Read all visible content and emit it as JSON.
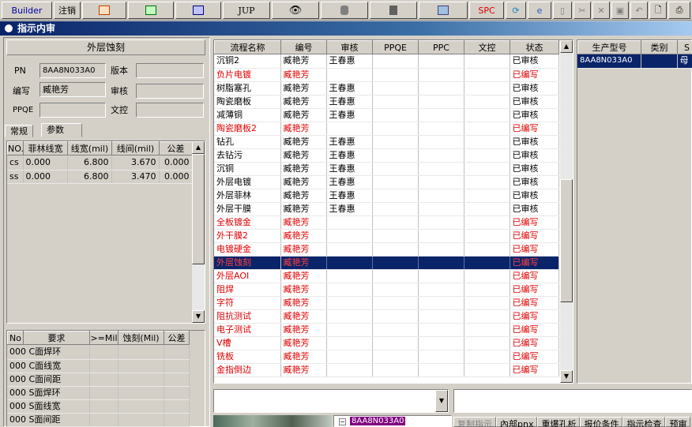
{
  "toolbar": {
    "builder": "Builder",
    "logout": "注销",
    "jup": "JUP",
    "spc": "SPC"
  },
  "window": {
    "title": "指示内审"
  },
  "left": {
    "header": "外层蚀刻",
    "pn_label": "PN",
    "pn_value": "8AA8N033A0",
    "version_label": "版本",
    "version_value": "",
    "editor_label": "编写",
    "editor_value": "臧艳芳",
    "reviewer_label": "审核",
    "reviewer_value": "",
    "ppqe_label": "PPQE",
    "ppqe_value": "",
    "doc_label": "文控",
    "doc_value": "",
    "tabs": [
      "常规",
      "参数"
    ],
    "param_headers": [
      "NO.",
      "菲林线宽",
      "线宽(mil)",
      "线间(mil)",
      "公差"
    ],
    "params": [
      [
        "cs",
        "0.000",
        "6.800",
        "3.670",
        "0.000"
      ],
      [
        "ss",
        "0.000",
        "6.800",
        "3.470",
        "0.000"
      ]
    ],
    "req_headers": [
      "No",
      "要求",
      ">=Mil",
      "蚀刻(Mil)",
      "公差"
    ],
    "reqs": [
      "000 C面焊环",
      "000 C面线宽",
      "000 C面间距",
      "000 S面焊环",
      "000 S面线宽",
      "000 S面间距"
    ]
  },
  "process": {
    "headers": [
      "流程名称",
      "编号",
      "审核",
      "PPQE",
      "PPC",
      "文控",
      "状态"
    ],
    "rows": [
      {
        "name": "沉铜2",
        "code": "臧艳芳",
        "rev": "王春惠",
        "status": "已审核",
        "red": false
      },
      {
        "name": "负片电镀",
        "code": "臧艳芳",
        "rev": "",
        "status": "已编写",
        "red": true
      },
      {
        "name": "树脂塞孔",
        "code": "臧艳芳",
        "rev": "王春惠",
        "status": "已审核",
        "red": false
      },
      {
        "name": "陶瓷磨板",
        "code": "臧艳芳",
        "rev": "王春惠",
        "status": "已审核",
        "red": false
      },
      {
        "name": "减薄铜",
        "code": "臧艳芳",
        "rev": "王春惠",
        "status": "已审核",
        "red": false
      },
      {
        "name": "陶瓷磨板2",
        "code": "臧艳芳",
        "rev": "",
        "status": "已编写",
        "red": true
      },
      {
        "name": "钻孔",
        "code": "臧艳芳",
        "rev": "王春惠",
        "status": "已审核",
        "red": false
      },
      {
        "name": "去钻污",
        "code": "臧艳芳",
        "rev": "王春惠",
        "status": "已审核",
        "red": false
      },
      {
        "name": "沉铜",
        "code": "臧艳芳",
        "rev": "王春惠",
        "status": "已审核",
        "red": false
      },
      {
        "name": "外层电镀",
        "code": "臧艳芳",
        "rev": "王春惠",
        "status": "已审核",
        "red": false
      },
      {
        "name": "外层菲林",
        "code": "臧艳芳",
        "rev": "王春惠",
        "status": "已审核",
        "red": false
      },
      {
        "name": "外层干膜",
        "code": "臧艳芳",
        "rev": "王春惠",
        "status": "已审核",
        "red": false
      },
      {
        "name": "全板镀金",
        "code": "臧艳芳",
        "rev": "",
        "status": "已编写",
        "red": true
      },
      {
        "name": "外干膜2",
        "code": "臧艳芳",
        "rev": "",
        "status": "已编写",
        "red": true
      },
      {
        "name": "电镀硬金",
        "code": "臧艳芳",
        "rev": "",
        "status": "已编写",
        "red": true
      },
      {
        "name": "外层蚀刻",
        "code": "臧艳芳",
        "rev": "",
        "status": "已编写",
        "red": true,
        "selected": true
      },
      {
        "name": "外层AOI",
        "code": "臧艳芳",
        "rev": "",
        "status": "已编写",
        "red": true
      },
      {
        "name": "阻焊",
        "code": "臧艳芳",
        "rev": "",
        "status": "已编写",
        "red": true
      },
      {
        "name": "字符",
        "code": "臧艳芳",
        "rev": "",
        "status": "已编写",
        "red": true
      },
      {
        "name": "阻抗测试",
        "code": "臧艳芳",
        "rev": "",
        "status": "已编写",
        "red": true
      },
      {
        "name": "电子测试",
        "code": "臧艳芳",
        "rev": "",
        "status": "已编写",
        "red": true
      },
      {
        "name": "V槽",
        "code": "臧艳芳",
        "rev": "",
        "status": "已编写",
        "red": true
      },
      {
        "name": "铣板",
        "code": "臧艳芳",
        "rev": "",
        "status": "已编写",
        "red": true
      },
      {
        "name": "金指倒边",
        "code": "臧艳芳",
        "rev": "",
        "status": "已编写",
        "red": true
      }
    ]
  },
  "right": {
    "headers": [
      "生产型号",
      "类别",
      "S"
    ],
    "row": [
      "8AA8N033A0",
      "",
      "母"
    ]
  },
  "bottom": {
    "tree_item": "8AA8N033A0",
    "tabs": [
      "复制指示",
      "內部pnx",
      "重爆孔析",
      "报价条件",
      "指示检查",
      "预审"
    ]
  }
}
